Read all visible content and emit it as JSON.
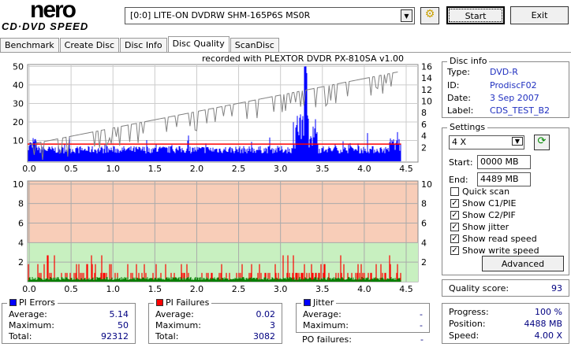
{
  "header": {
    "logo_top": "nero",
    "logo_bottom": "CD·DVD SPEED",
    "drive": "[0:0]  LITE-ON DVDRW SHM-165P6S MS0R",
    "start": "Start",
    "exit": "Exit"
  },
  "tabs": [
    {
      "label": "Benchmark"
    },
    {
      "label": "Create Disc"
    },
    {
      "label": "Disc Info"
    },
    {
      "label": "Disc Quality",
      "active": true
    },
    {
      "label": "ScanDisc"
    }
  ],
  "recorded_with": "recorded with PLEXTOR DVDR   PX-810SA  v1.00",
  "chart_data": [
    {
      "type": "bar",
      "series": [
        {
          "values_desc": "PI errors per position",
          "color": "#0000ff"
        },
        {
          "type": "line",
          "color": "#808080"
        }
      ],
      "x_ticks": [
        "0.0",
        "0.5",
        "1.0",
        "1.5",
        "2.0",
        "2.5",
        "3.0",
        "3.5",
        "4.0",
        "4.5"
      ],
      "xlim": [
        0,
        4.5
      ],
      "y_ticks": [
        "10",
        "20",
        "30",
        "40",
        "50"
      ],
      "ylim": [
        0,
        50
      ],
      "y2_ticks": [
        "2",
        "4",
        "6",
        "8",
        "10",
        "12",
        "14",
        "16"
      ],
      "y2lim": [
        0,
        16
      ],
      "pi_max": 50,
      "pi_max_at": 3.3,
      "pi_average": 5.14,
      "threshold_line": 8,
      "threshold_color": "#ff0000",
      "grid": true
    },
    {
      "type": "bar",
      "series": [
        {
          "color": "#ff0000"
        }
      ],
      "x_ticks": [
        "0.0",
        "0.5",
        "1.0",
        "1.5",
        "2.0",
        "2.5",
        "3.0",
        "3.5",
        "4.0",
        "4.5"
      ],
      "xlim": [
        0,
        4.5
      ],
      "y_ticks": [
        "2",
        "4",
        "6",
        "8",
        "10"
      ],
      "ylim": [
        0,
        10
      ],
      "y2_ticks": [
        "2",
        "4",
        "6",
        "8",
        "10"
      ],
      "pif_max": 3,
      "good_band_max": 4,
      "grid": true
    }
  ],
  "disc_info": {
    "title": "Disc info",
    "type_label": "Type:",
    "type": "DVD-R",
    "id_label": "ID:",
    "id": "ProdiscF02",
    "date_label": "Date:",
    "date": "3 Sep 2007",
    "label_label": "Label:",
    "label": "CDS_TEST_B2"
  },
  "settings": {
    "title": "Settings",
    "speed": "4 X",
    "start_label": "Start:",
    "start": "0000 MB",
    "end_label": "End:",
    "end": "4489 MB",
    "checks": [
      {
        "label": "Quick scan",
        "checked": false
      },
      {
        "label": "Show C1/PIE",
        "checked": true
      },
      {
        "label": "Show C2/PIF",
        "checked": true
      },
      {
        "label": "Show jitter",
        "checked": true
      },
      {
        "label": "Show read speed",
        "checked": true
      },
      {
        "label": "Show write speed",
        "checked": true
      }
    ],
    "advanced": "Advanced"
  },
  "quality": {
    "label": "Quality score:",
    "value": "93"
  },
  "progress": {
    "progress_label": "Progress:",
    "progress": "100 %",
    "position_label": "Position:",
    "position": "4488 MB",
    "speed_label": "Speed:",
    "speed": "4.00 X"
  },
  "pi_errors": {
    "title": "PI Errors",
    "color": "#0000ff",
    "avg_label": "Average:",
    "avg": "5.14",
    "max_label": "Maximum:",
    "max": "50",
    "total_label": "Total:",
    "total": "92312"
  },
  "pi_failures": {
    "title": "PI Failures",
    "color": "#ff0000",
    "avg_label": "Average:",
    "avg": "0.02",
    "max_label": "Maximum:",
    "max": "3",
    "total_label": "Total:",
    "total": "3082"
  },
  "jitter": {
    "title": "Jitter",
    "color": "#0000ff",
    "avg_label": "Average:",
    "avg": "-",
    "max_label": "Maximum:",
    "max": "-",
    "po_label": "PO failures:",
    "po": "-"
  }
}
